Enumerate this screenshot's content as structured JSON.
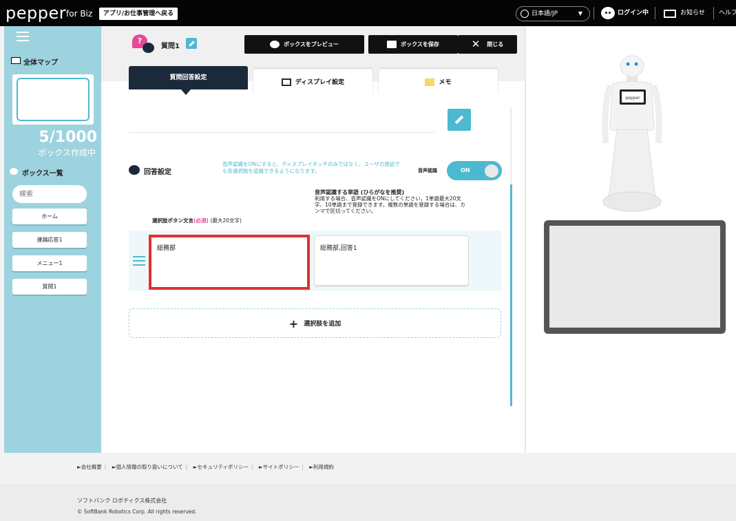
{
  "topbar": {
    "logo": "pepper",
    "logo_sub": "for Biz",
    "back_button": "アプリ/お仕事管理へ戻る",
    "language": "日本語/JP",
    "login": "ログイン中",
    "notice": "お知らせ",
    "help": "ヘルプ"
  },
  "sidebar": {
    "map_label": "全体マップ",
    "box_count": "5/1000",
    "box_count_label": "ボックス作成中",
    "box_list_label": "ボックス一覧",
    "search_placeholder": "検索",
    "items": [
      {
        "label": "ホーム"
      },
      {
        "label": "連鶏応答1"
      },
      {
        "label": "メニュー1"
      },
      {
        "label": "質問1"
      }
    ]
  },
  "header": {
    "box_title": "質問1",
    "preview_button": "ボックスをプレビュー",
    "save_button": "ボックスを保存",
    "close_button": "閉じる"
  },
  "tabs": [
    {
      "label": "質問回答設定",
      "active": true
    },
    {
      "label": "ディスプレイ設定",
      "active": false
    },
    {
      "label": "メモ",
      "active": false
    }
  ],
  "answer_settings": {
    "label": "回答設定",
    "voice_description": "音声認識をONにすると、ディスプレイタッチのみではなく、ユーザの発話でも各選択肢を認識できるようになります。",
    "voice_label": "音声認識",
    "voice_toggle": "ON",
    "choice_label": "選択肢ボタン文言",
    "choice_required": "(必須)",
    "choice_max": "(最大20文字)",
    "words_title": "音声認識する単語 (ひらがなを推奨)",
    "words_description": "利用する場合、音声認識をONにしてください。1単語最大20文字、10単語まで登録できます。複数の単語を登録する場合は、カンマで区切ってください。",
    "choices": [
      {
        "text": "総務部",
        "words": "総務部,回答1"
      }
    ],
    "add_choice": "選択肢を追加"
  },
  "footer": {
    "links": [
      "►会社概要",
      "►個人情報の取り扱いについて",
      "►セキュリティポリシー",
      "►サイトポリシー",
      "►利用規約"
    ],
    "company": "ソフトバンク ロボティクス株式会社",
    "copyright": "© SoftBank Robotics Corp. All rights reserved."
  },
  "colors": {
    "accent": "#4db9d1",
    "sidebar": "#9dd3df",
    "dark": "#1b2a3a",
    "highlight": "#e62d2d",
    "required": "#e8479a"
  }
}
